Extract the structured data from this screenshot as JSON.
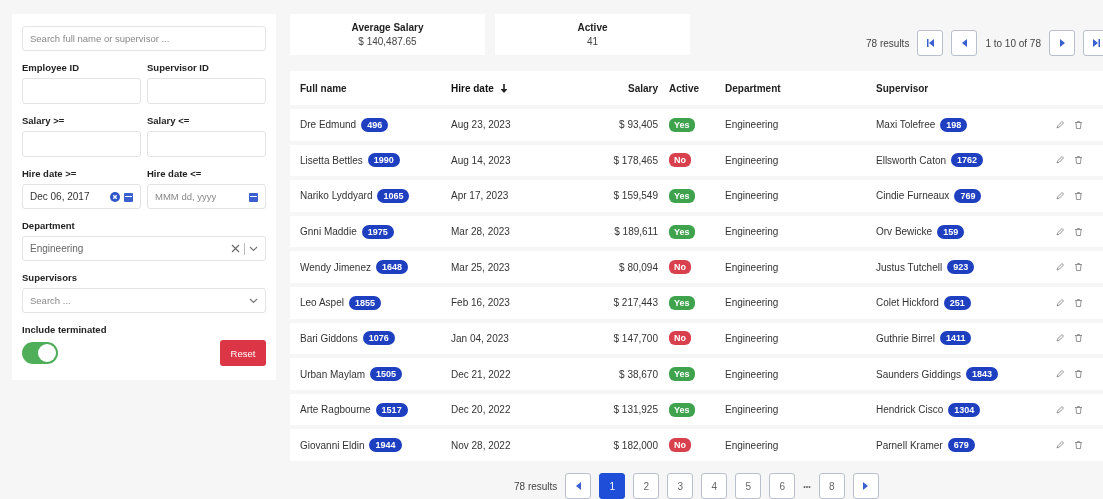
{
  "filters": {
    "search": {
      "placeholder": "Search full name or supervisor ..."
    },
    "employee_id": {
      "label": "Employee ID"
    },
    "supervisor_id": {
      "label": "Supervisor ID"
    },
    "salary_min": {
      "label": "Salary >="
    },
    "salary_max": {
      "label": "Salary <="
    },
    "hire_from": {
      "label": "Hire date >=",
      "value": "Dec 06, 2017"
    },
    "hire_to": {
      "label": "Hire date <=",
      "placeholder": "MMM dd, yyyy"
    },
    "department": {
      "label": "Department",
      "value": "Engineering"
    },
    "supervisors": {
      "label": "Supervisors",
      "placeholder": "Search ..."
    },
    "include_terminated": {
      "label": "Include terminated",
      "on": true
    },
    "reset": "Reset"
  },
  "stats": [
    {
      "label": "Average Salary",
      "value": "$ 140,487.65"
    },
    {
      "label": "Active",
      "value": "41"
    }
  ],
  "top_pager": {
    "results": "78 results",
    "range": "1 to 10 of 78"
  },
  "table": {
    "columns": [
      {
        "label": "Full name",
        "sorted": false
      },
      {
        "label": "Hire date",
        "sorted": true
      },
      {
        "label": "Salary",
        "sorted": false
      },
      {
        "label": "Active",
        "sorted": false
      },
      {
        "label": "Department",
        "sorted": false
      },
      {
        "label": "Supervisor",
        "sorted": false
      }
    ],
    "rows": [
      {
        "name": "Dre Edmund",
        "id": "496",
        "hire_date": "Aug 23, 2023",
        "salary": "$ 93,405",
        "active": true,
        "active_label": "Yes",
        "department": "Engineering",
        "supervisor": "Maxi Tolefree",
        "supervisor_id": "198"
      },
      {
        "name": "Lisetta Bettles",
        "id": "1990",
        "hire_date": "Aug 14, 2023",
        "salary": "$ 178,465",
        "active": false,
        "active_label": "No",
        "department": "Engineering",
        "supervisor": "Ellsworth Caton",
        "supervisor_id": "1762"
      },
      {
        "name": "Nariko Lyddyard",
        "id": "1065",
        "hire_date": "Apr 17, 2023",
        "salary": "$ 159,549",
        "active": true,
        "active_label": "Yes",
        "department": "Engineering",
        "supervisor": "Cindie Furneaux",
        "supervisor_id": "769"
      },
      {
        "name": "Gnni Maddie",
        "id": "1975",
        "hire_date": "Mar 28, 2023",
        "salary": "$ 189,611",
        "active": true,
        "active_label": "Yes",
        "department": "Engineering",
        "supervisor": "Orv Bewicke",
        "supervisor_id": "159"
      },
      {
        "name": "Wendy Jimenez",
        "id": "1648",
        "hire_date": "Mar 25, 2023",
        "salary": "$ 80,094",
        "active": false,
        "active_label": "No",
        "department": "Engineering",
        "supervisor": "Justus Tutchell",
        "supervisor_id": "923"
      },
      {
        "name": "Leo Aspel",
        "id": "1855",
        "hire_date": "Feb 16, 2023",
        "salary": "$ 217,443",
        "active": true,
        "active_label": "Yes",
        "department": "Engineering",
        "supervisor": "Colet Hickford",
        "supervisor_id": "251"
      },
      {
        "name": "Bari Giddons",
        "id": "1076",
        "hire_date": "Jan 04, 2023",
        "salary": "$ 147,700",
        "active": false,
        "active_label": "No",
        "department": "Engineering",
        "supervisor": "Guthrie Birrel",
        "supervisor_id": "1411"
      },
      {
        "name": "Urban Maylam",
        "id": "1505",
        "hire_date": "Dec 21, 2022",
        "salary": "$ 38,670",
        "active": true,
        "active_label": "Yes",
        "department": "Engineering",
        "supervisor": "Saunders Giddings",
        "supervisor_id": "1843"
      },
      {
        "name": "Arte Ragbourne",
        "id": "1517",
        "hire_date": "Dec 20, 2022",
        "salary": "$ 131,925",
        "active": true,
        "active_label": "Yes",
        "department": "Engineering",
        "supervisor": "Hendrick Cisco",
        "supervisor_id": "1304"
      },
      {
        "name": "Giovanni Eldin",
        "id": "1944",
        "hire_date": "Nov 28, 2022",
        "salary": "$ 182,000",
        "active": false,
        "active_label": "No",
        "department": "Engineering",
        "supervisor": "Parnell Kramer",
        "supervisor_id": "679"
      }
    ]
  },
  "bottom_pager": {
    "results": "78 results",
    "pages": [
      {
        "kind": "page",
        "label": "1",
        "selected": true
      },
      {
        "kind": "page",
        "label": "2",
        "selected": false
      },
      {
        "kind": "page",
        "label": "3",
        "selected": false
      },
      {
        "kind": "page",
        "label": "4",
        "selected": false
      },
      {
        "kind": "page",
        "label": "5",
        "selected": false
      },
      {
        "kind": "page",
        "label": "6",
        "selected": false
      },
      {
        "kind": "ellipsis",
        "label": "•••"
      },
      {
        "kind": "page",
        "label": "8",
        "selected": false
      }
    ]
  }
}
